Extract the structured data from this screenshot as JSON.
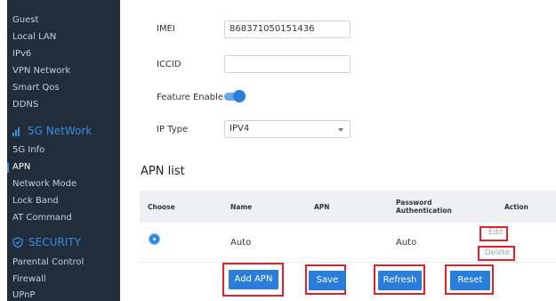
{
  "sidebar": {
    "network_items": [
      {
        "label": "Guest"
      },
      {
        "label": "Local LAN"
      },
      {
        "label": "IPv6"
      },
      {
        "label": "VPN Network"
      },
      {
        "label": "Smart Qos"
      },
      {
        "label": "DDNS"
      }
    ],
    "network5g": {
      "title": "5G NetWork",
      "icon": "signal-bars-icon",
      "items": [
        {
          "label": "5G Info"
        },
        {
          "label": "APN",
          "active": true
        },
        {
          "label": "Network Mode"
        },
        {
          "label": "Lock Band"
        },
        {
          "label": "AT Command"
        }
      ]
    },
    "security": {
      "title": "SECURITY",
      "icon": "shield-icon",
      "items": [
        {
          "label": "Parental Control"
        },
        {
          "label": "Firewall"
        },
        {
          "label": "UPnP"
        }
      ]
    }
  },
  "form": {
    "imei_label": "IMEI",
    "imei_value": "868371050151436",
    "iccid_label": "ICCID",
    "iccid_value": "",
    "feature_label": "Feature Enable",
    "feature_enabled": true,
    "iptype_label": "IP Type",
    "iptype_value": "IPV4"
  },
  "apn_list": {
    "title": "APN list",
    "columns": {
      "choose": "Choose",
      "name": "Name",
      "apn": "APN",
      "password1": "Password",
      "password2": "Authentication",
      "action": "Action"
    },
    "rows": [
      {
        "selected": true,
        "name": "Auto",
        "apn": "",
        "auth": "Auto",
        "edit": "Edit",
        "delete": "Delete"
      }
    ]
  },
  "buttons": {
    "add_apn": "Add APN",
    "save": "Save",
    "refresh": "Refresh",
    "reset": "Reset"
  },
  "colors": {
    "sidebar_bg": "#222d3c",
    "accent": "#2a7dd8",
    "highlight_box": "#e0202a"
  }
}
